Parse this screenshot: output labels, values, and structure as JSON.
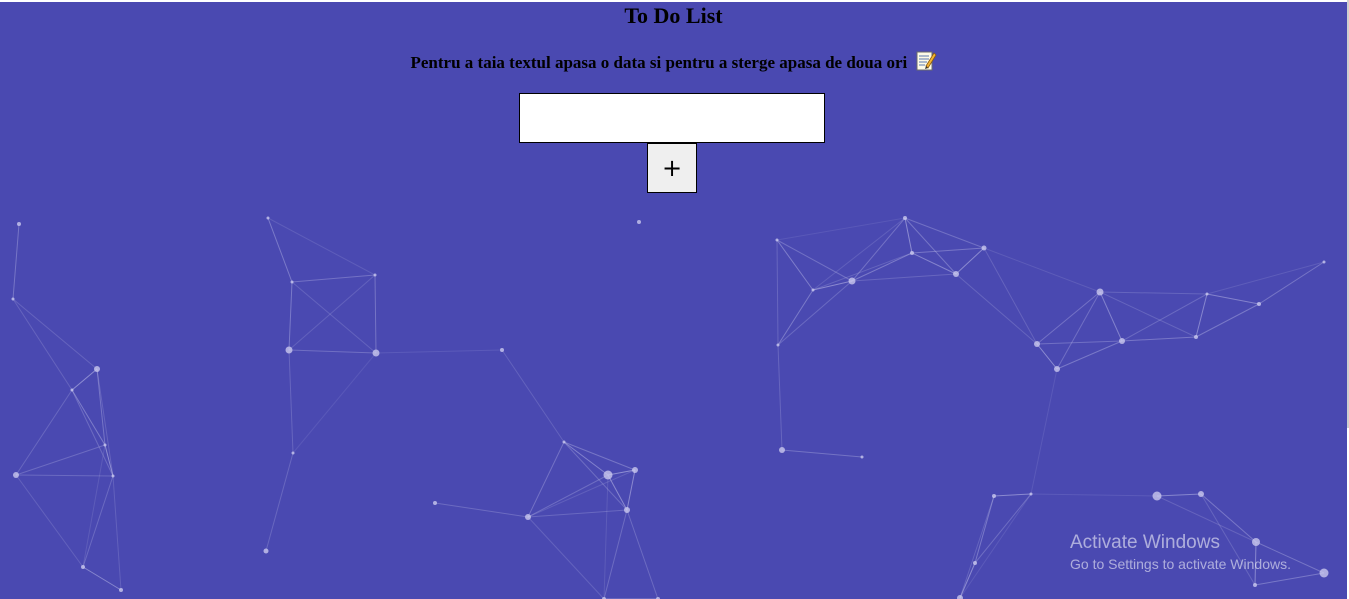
{
  "app": {
    "title": "To Do List",
    "instructions": "Pentru a taia textul apasa o data si pentru a sterge apasa de doua ori",
    "instructions_icon": "memo-icon"
  },
  "form": {
    "input_value": "",
    "add_button_label": "+"
  },
  "watermark": {
    "title": "Activate Windows",
    "subtitle": "Go to Settings to activate Windows."
  },
  "colors": {
    "background": "#4a49b1",
    "particle": "#c9c8ee"
  }
}
